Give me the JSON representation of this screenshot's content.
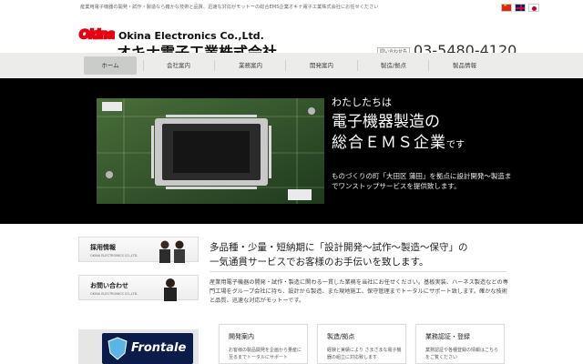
{
  "top": {
    "tagline": "産業用電子機器の開発・試作・製造なら確かな技術と品質、迅速な対応がモットーの総合EMS企業オキナ電子工業株式会社にお任せください",
    "flags": [
      "china-flag-icon",
      "uk-flag-icon",
      "japan-flag-icon"
    ]
  },
  "header": {
    "logo_mark": "Okina",
    "company_en": "Okina Electronics Co.,Ltd.",
    "company_jp": "オキナ電子工業株式会社",
    "tel_label": "問い合わせ先",
    "tel_number": "03-5480-4120"
  },
  "nav": {
    "items": [
      {
        "label": "ホーム"
      },
      {
        "label": "会社案内"
      },
      {
        "label": "業務案内"
      },
      {
        "label": "開発案内"
      },
      {
        "label": "製造/拠点"
      },
      {
        "label": "製品情報"
      }
    ]
  },
  "hero": {
    "line1": "わたしたちは",
    "line2": "電子機器製造の",
    "line3_main": "総合ＥＭＳ企業",
    "line3_suffix": "です",
    "body": "ものづくりの町「大田区 蒲田」を拠点に設計開発〜製造までワンストップサービスを提供致します。"
  },
  "sidebar": {
    "banners": [
      {
        "title": "採用情報",
        "sub": "OKINA ELECTRONICS CO.,LTD."
      },
      {
        "title": "お問い合わせ",
        "sub": "OKINA ELECTRONICS CO.,LTD."
      }
    ],
    "sponsor": "Frontale"
  },
  "main": {
    "heading1": "多品種・少量・短納期に「設計開発〜試作〜製造〜保守」の",
    "heading2": "一気通貫サービスでお客様のお手伝いを致します。",
    "body": "産業用電子機器の開発・試作・製造に関わる一貫した業務を当社にお任せください。基板実装、ハーネス製造などの専門工場をグループ会社に持ち、設計から製造、また現地施工、保守管理までトータルにサポート致します。確かな技術と品質、迅速な対応がモットーです。"
  },
  "cards": [
    {
      "title": "開発案内",
      "text": "お客様の製品開発を企画から量産に至るまでトータルにサポート"
    },
    {
      "title": "製造/拠点",
      "text": "経験と実績により さまざまな電子機器の組立に対応致します"
    },
    {
      "title": "業務認証・登録",
      "text": "業務認証や各種登録の情報はこちらをご覧ください"
    }
  ],
  "colors": {
    "hero_bg": "#000000",
    "nav_bg": "#ececea",
    "logo_red": "#e60012"
  }
}
